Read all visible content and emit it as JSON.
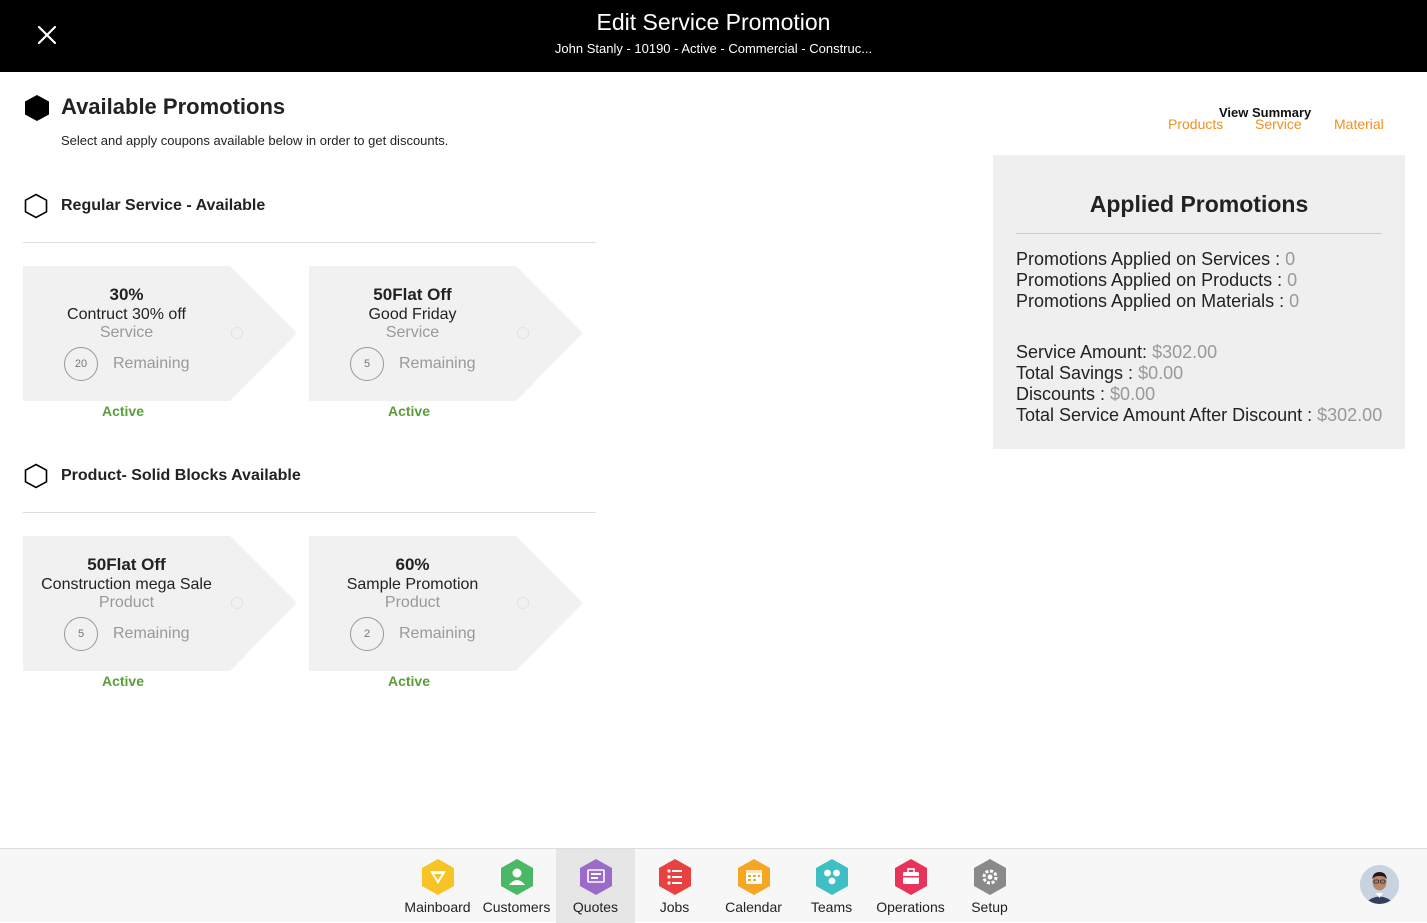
{
  "header": {
    "title": "Edit Service Promotion",
    "subtitle": "John Stanly - 10190 - Active - Commercial - Construc..."
  },
  "main": {
    "heading": "Available Promotions",
    "description": "Select and apply coupons available below in order to get discounts."
  },
  "sections": [
    {
      "title": "Regular Service - Available",
      "coupons": [
        {
          "title": "30%",
          "name": "Contruct 30% off",
          "type": "Service",
          "count": "20",
          "remaining_label": "Remaining",
          "status": "Active"
        },
        {
          "title": "50Flat Off",
          "name": "Good Friday",
          "type": "Service",
          "count": "5",
          "remaining_label": "Remaining",
          "status": "Active"
        }
      ]
    },
    {
      "title": "Product- Solid Blocks Available",
      "coupons": [
        {
          "title": "50Flat Off",
          "name": "Construction mega Sale",
          "type": "Product",
          "count": "5",
          "remaining_label": "Remaining",
          "status": "Active"
        },
        {
          "title": "60%",
          "name": "Sample Promotion",
          "type": "Product",
          "count": "2",
          "remaining_label": "Remaining",
          "status": "Active"
        }
      ]
    }
  ],
  "summary_links": {
    "view_summary": "View Summary",
    "products": "Products",
    "service": "Service",
    "material": "Material"
  },
  "applied": {
    "title": "Applied Promotions",
    "services_label": "Promotions Applied on Services : ",
    "services_value": "0",
    "products_label": "Promotions Applied on Products : ",
    "products_value": "0",
    "materials_label": "Promotions Applied on Materials : ",
    "materials_value": "0",
    "service_amount_label": "Service Amount: ",
    "service_amount_value": "$302.00",
    "total_savings_label": "Total Savings : ",
    "total_savings_value": "$0.00",
    "discounts_label": "Discounts : ",
    "discounts_value": "$0.00",
    "after_discount_label": "Total Service Amount After Discount : ",
    "after_discount_value": "$302.00"
  },
  "nav": {
    "items": [
      {
        "label": "Mainboard",
        "icon": "mainboard-icon",
        "color": "#f7c325"
      },
      {
        "label": "Customers",
        "icon": "customers-icon",
        "color": "#4bb865"
      },
      {
        "label": "Quotes",
        "icon": "quotes-icon",
        "color": "#9b6bc9"
      },
      {
        "label": "Jobs",
        "icon": "jobs-icon",
        "color": "#e94040"
      },
      {
        "label": "Calendar",
        "icon": "calendar-icon",
        "color": "#f5a623"
      },
      {
        "label": "Teams",
        "icon": "teams-icon",
        "color": "#3fbfc4"
      },
      {
        "label": "Operations",
        "icon": "operations-icon",
        "color": "#e8345a"
      },
      {
        "label": "Setup",
        "icon": "setup-icon",
        "color": "#8a8a8a"
      }
    ],
    "active": "Quotes"
  },
  "colors": {
    "accent_orange": "#f0901e",
    "status_green": "#5a9e3a",
    "header_bg": "#000000",
    "card_bg": "#f1f1f1"
  }
}
